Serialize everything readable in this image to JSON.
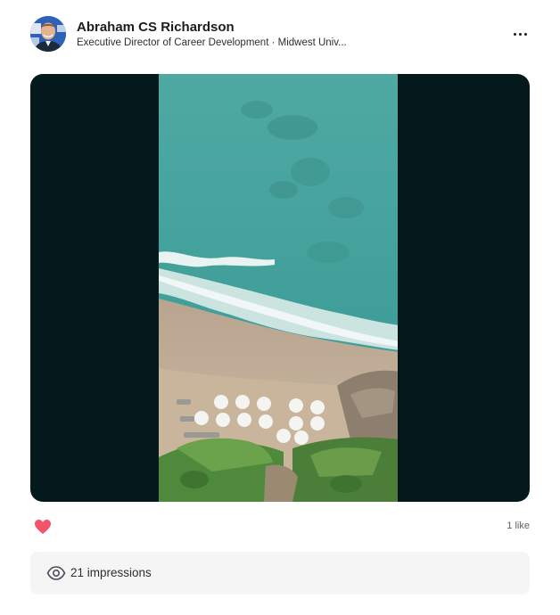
{
  "post": {
    "author": {
      "name": "Abraham CS Richardson",
      "headline": "Executive Director of Career Development · Midwest Univ..."
    },
    "more_icon": "more-horizontal-icon",
    "media": {
      "type": "video",
      "background_color": "#03191b",
      "subject": "aerial beach with umbrellas"
    },
    "reactions": {
      "icon": "heart-icon",
      "color": "#f2546a",
      "likes_label": "1 like"
    },
    "impressions": {
      "icon": "eye-icon",
      "label": "21 impressions"
    }
  }
}
